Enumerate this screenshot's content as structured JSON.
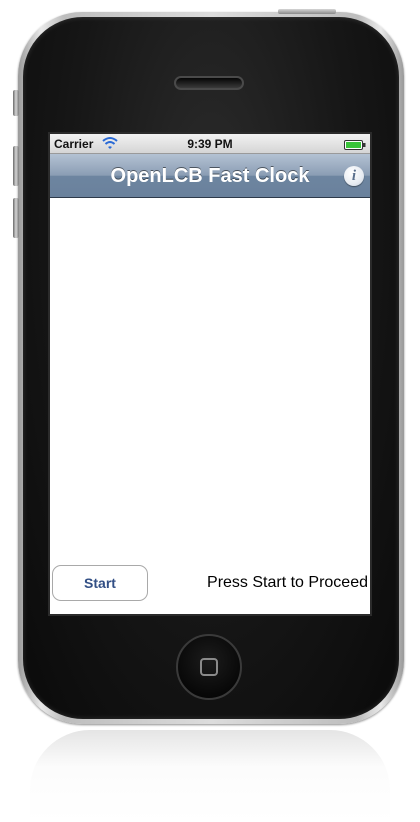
{
  "status_bar": {
    "carrier": "Carrier",
    "time": "9:39 PM",
    "wifi_icon": "wifi-icon",
    "battery_icon": "battery-full-icon",
    "battery_color": "#3ac43a"
  },
  "nav_bar": {
    "title": "OpenLCB Fast Clock",
    "info_button_label": "i",
    "info_icon": "info-icon",
    "color": "#6d85a0"
  },
  "main": {
    "start_button_label": "Start",
    "status_message": "Press Start to Proceed"
  },
  "device": {
    "home_icon": "home-button-icon"
  }
}
